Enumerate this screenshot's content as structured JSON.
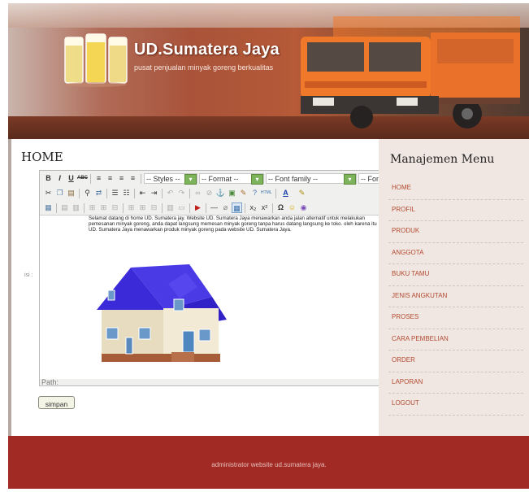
{
  "header": {
    "brand": "UD.Sumatera Jaya",
    "tagline": "pusat penjualan minyak goreng berkualitas"
  },
  "content": {
    "page_title": "HOME",
    "field_label": "isi :",
    "editor": {
      "toolbar1": {
        "bold": "B",
        "italic": "I",
        "underline": "U",
        "strike": "ABC",
        "styles": "-- Styles --",
        "format": "-- Format --",
        "font_family": "-- Font family --",
        "font_size": "-- Font size --"
      },
      "body_text": "Selamat datang di home UD. Sumatera jay. Website UD. Sumatera Jaya menawarkan anda jalan alternatif untuk melakukan pemesanan minyak goreng, anda dapat langsung memesan minyak goreng tanpa harus datang langsung ke toko. oleh karena itu UD. Sumatera Jaya menawarkan produk minyak goreng pada website UD. Sumatera Jaya.",
      "path_label": "Path:"
    },
    "save_label": "simpan"
  },
  "sidebar": {
    "title": "Manajemen Menu",
    "items": [
      {
        "label": "HOME"
      },
      {
        "label": "PROFIL"
      },
      {
        "label": "PRODUK"
      },
      {
        "label": "ANGGOTA"
      },
      {
        "label": "BUKU TAMU"
      },
      {
        "label": "JENIS ANGKUTAN"
      },
      {
        "label": "PROSES"
      },
      {
        "label": "CARA PEMBELIAN"
      },
      {
        "label": "ORDER"
      },
      {
        "label": "LAPORAN"
      },
      {
        "label": "LOGOUT"
      }
    ]
  },
  "footer": {
    "text": "administrator website ud.sumatera jaya."
  },
  "colors": {
    "accent": "#b24a2f",
    "footer_bg": "#a12a24",
    "sidebar_bg": "#f0e7e3",
    "scroll_green": "#7db35a"
  }
}
